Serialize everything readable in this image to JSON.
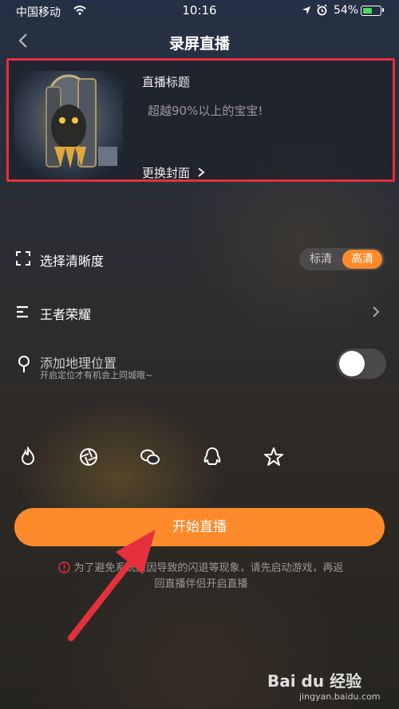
{
  "status_bar": {
    "carrier": "中国移动",
    "time": "10:16",
    "battery_percent": "54%",
    "battery_level": 0.54
  },
  "nav": {
    "title": "录屏直播",
    "back_icon": "chevron-left-icon"
  },
  "cover_card": {
    "title_label": "直播标题",
    "title_placeholder": "超越90%以上的宝宝!",
    "change_cover_label": "更换封面",
    "highlight_color": "#e5303d"
  },
  "resolution": {
    "label": "选择清晰度",
    "icon": "fullscreen-icon",
    "options": [
      "标清",
      "高清"
    ],
    "selected": "高清"
  },
  "game": {
    "label": "王者荣耀",
    "icon": "menu-list-icon"
  },
  "location": {
    "label": "添加地理位置",
    "sublabel": "开启定位才有机会上同城哦~",
    "icon": "location-pin-icon",
    "enabled": false
  },
  "share": {
    "icons": [
      "fire-icon",
      "aperture-icon",
      "wechat-icon",
      "qq-icon",
      "star-icon"
    ]
  },
  "start_button": {
    "label": "开始直播",
    "color": "#ff8a2b"
  },
  "tip": {
    "text_line1": "为了避免系统原因导致的闪退等现象，请先启动游戏，再返",
    "text_line2": "回直播伴侣开启直播"
  },
  "watermark": {
    "brand": "Bai du 经验",
    "url": "jingyan.baidu.com"
  },
  "colors": {
    "accent": "#ff8a2b",
    "annotation_red": "#e5303d"
  }
}
